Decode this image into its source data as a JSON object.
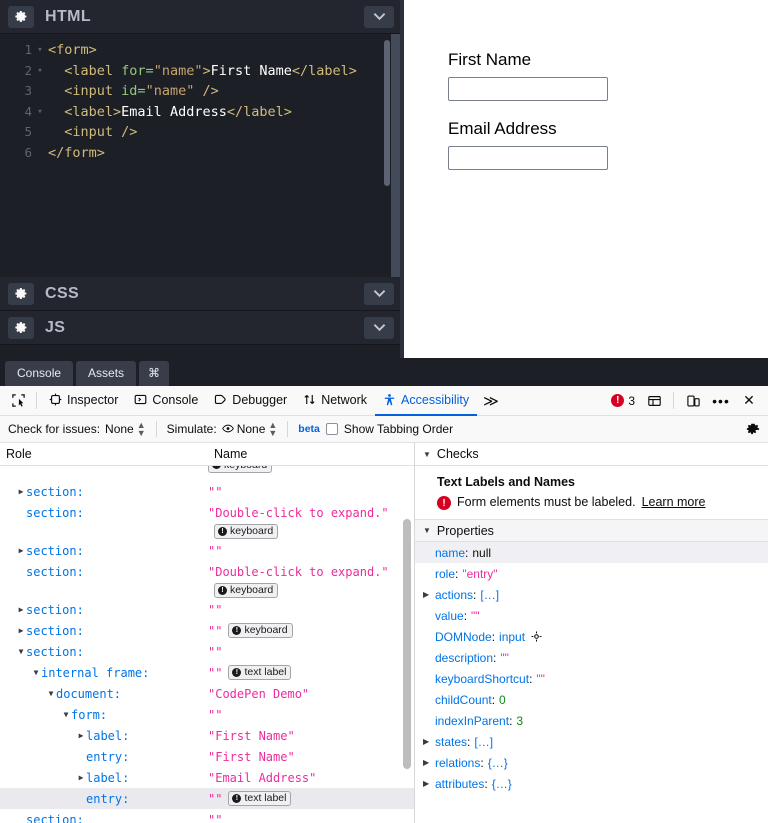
{
  "codepen": {
    "editors": [
      {
        "title": "HTML",
        "gear_icon": "gear-icon",
        "chevron_icon": "chevron-down-icon"
      },
      {
        "title": "CSS",
        "gear_icon": "gear-icon",
        "chevron_icon": "chevron-down-icon"
      },
      {
        "title": "JS",
        "gear_icon": "gear-icon",
        "chevron_icon": "chevron-down-icon"
      }
    ],
    "html_code": {
      "lines": [
        {
          "num": "1",
          "fold": "▾",
          "indent": 0
        },
        {
          "num": "2",
          "fold": "▾",
          "indent": 1
        },
        {
          "num": "3",
          "fold": "",
          "indent": 1
        },
        {
          "num": "4",
          "fold": "▾",
          "indent": 1
        },
        {
          "num": "5",
          "fold": "",
          "indent": 1
        },
        {
          "num": "6",
          "fold": "",
          "indent": 0
        }
      ],
      "l1": "<form>",
      "l2_open": "<label ",
      "l2_attr": "for=",
      "l2_val": "\"name\"",
      "l2_gt": ">",
      "l2_text": "First Name",
      "l2_close": "</label>",
      "l3_open": "<input ",
      "l3_attr": "id=",
      "l3_val": "\"name\"",
      "l3_close": " />",
      "l4_open": "<label>",
      "l4_text": "Email Address",
      "l4_close": "</label>",
      "l5": "<input />",
      "l6": "</form>"
    },
    "preview": {
      "label_first": "First Name",
      "label_email": "Email Address",
      "input_first_value": "",
      "input_email_value": ""
    }
  },
  "devtools": {
    "pen_tabs": [
      {
        "label": "Console"
      },
      {
        "label": "Assets"
      },
      {
        "label": "⌘"
      }
    ],
    "picker_icon": "element-picker-icon",
    "tabs": [
      {
        "label": "Inspector",
        "icon": "inspector-icon",
        "active": false
      },
      {
        "label": "Console",
        "icon": "console-icon",
        "active": false
      },
      {
        "label": "Debugger",
        "icon": "debugger-icon",
        "active": false
      },
      {
        "label": "Network",
        "icon": "network-icon",
        "active": false
      },
      {
        "label": "Accessibility",
        "icon": "accessibility-icon",
        "active": true
      }
    ],
    "overflow_label": "≫",
    "error_count": "3",
    "right_icons": [
      {
        "name": "layout-toggle-icon"
      },
      {
        "name": "responsive-design-mode-icon"
      },
      {
        "name": "more-options-icon",
        "glyph": "•••"
      },
      {
        "name": "close-icon",
        "glyph": "✕"
      }
    ],
    "subtoolbar": {
      "check_label": "Check for issues:",
      "check_value": "None",
      "simulate_label": "Simulate:",
      "simulate_value": "None",
      "simulate_icon": "eye-icon",
      "beta_label": "beta",
      "tabbing_label": "Show Tabbing Order",
      "tabbing_checked": false,
      "settings_icon": "gear-icon"
    },
    "tree": {
      "col_role": "Role",
      "col_name": "Name",
      "rows": [
        {
          "role": "",
          "name": "",
          "indent": 0,
          "twisty": "",
          "badge": "keyboard",
          "partial": true,
          "selected": false
        },
        {
          "role": "section:",
          "name": "\"\"",
          "indent": 1,
          "twisty": "▶",
          "badge": "",
          "selected": false
        },
        {
          "role": "section:",
          "name": "\"Double-click to expand.\"",
          "indent": 1,
          "twisty": "",
          "badge": "keyboard",
          "badge_below": true,
          "selected": false
        },
        {
          "role": "section:",
          "name": "\"\"",
          "indent": 1,
          "twisty": "▶",
          "badge": "",
          "selected": false
        },
        {
          "role": "section:",
          "name": "\"Double-click to expand.\"",
          "indent": 1,
          "twisty": "",
          "badge": "keyboard",
          "badge_below": true,
          "selected": false
        },
        {
          "role": "section:",
          "name": "\"\"",
          "indent": 1,
          "twisty": "▶",
          "badge": "",
          "selected": false
        },
        {
          "role": "section:",
          "name": "\"\"",
          "indent": 1,
          "twisty": "▶",
          "badge": "keyboard",
          "selected": false
        },
        {
          "role": "section:",
          "name": "\"\"",
          "indent": 1,
          "twisty": "▼",
          "badge": "",
          "selected": false
        },
        {
          "role": "internal frame:",
          "name": "\"\"",
          "indent": 2,
          "twisty": "▼",
          "badge": "text label",
          "selected": false
        },
        {
          "role": "document:",
          "name": "\"CodePen Demo\"",
          "indent": 3,
          "twisty": "▼",
          "badge": "",
          "selected": false
        },
        {
          "role": "form:",
          "name": "\"\"",
          "indent": 4,
          "twisty": "▼",
          "badge": "",
          "selected": false
        },
        {
          "role": "label:",
          "name": "\"First Name\"",
          "indent": 5,
          "twisty": "▶",
          "badge": "",
          "selected": false
        },
        {
          "role": "entry:",
          "name": "\"First Name\"",
          "indent": 5,
          "twisty": "",
          "badge": "",
          "selected": false
        },
        {
          "role": "label:",
          "name": "\"Email Address\"",
          "indent": 5,
          "twisty": "▶",
          "badge": "",
          "selected": false
        },
        {
          "role": "entry:",
          "name": "\"\"",
          "indent": 5,
          "twisty": "",
          "badge": "text label",
          "selected": true
        },
        {
          "role": "section:",
          "name": "\"\"",
          "indent": 1,
          "twisty": "",
          "badge": "",
          "selected": false
        }
      ]
    },
    "checks": {
      "header": "Checks",
      "section_title": "Text Labels and Names",
      "issue_text": "Form elements must be labeled.",
      "learn_more": "Learn more",
      "properties_header": "Properties",
      "properties": [
        {
          "key": "name",
          "value": "null",
          "vtype": "null",
          "twisty": "",
          "alt": true
        },
        {
          "key": "role",
          "value": "\"entry\"",
          "vtype": "str",
          "twisty": "",
          "alt": false
        },
        {
          "key": "actions",
          "value": "[…]",
          "vtype": "plain",
          "twisty": "▶",
          "alt": false
        },
        {
          "key": "value",
          "value": "\"\"",
          "vtype": "str",
          "twisty": "",
          "alt": false
        },
        {
          "key": "DOMNode",
          "value": "input",
          "vtype": "dom",
          "twisty": "",
          "alt": false,
          "icon": "select-node-icon"
        },
        {
          "key": "description",
          "value": "\"\"",
          "vtype": "str",
          "twisty": "",
          "alt": false
        },
        {
          "key": "keyboardShortcut",
          "value": "\"\"",
          "vtype": "str",
          "twisty": "",
          "alt": false
        },
        {
          "key": "childCount",
          "value": "0",
          "vtype": "num",
          "twisty": "",
          "alt": false
        },
        {
          "key": "indexInParent",
          "value": "3",
          "vtype": "num",
          "twisty": "",
          "alt": false
        },
        {
          "key": "states",
          "value": "[…]",
          "vtype": "plain",
          "twisty": "▶",
          "alt": false
        },
        {
          "key": "relations",
          "value": "{…}",
          "vtype": "plain",
          "twisty": "▶",
          "alt": false
        },
        {
          "key": "attributes",
          "value": "{…}",
          "vtype": "plain",
          "twisty": "▶",
          "alt": false
        }
      ]
    }
  },
  "colors": {
    "accent_blue": "#0060df",
    "error_red": "#d70022",
    "string_pink": "#ed2c9b",
    "key_blue": "#0074e8",
    "number_green": "#0e8a16",
    "editor_bg": "#1d1f26"
  }
}
